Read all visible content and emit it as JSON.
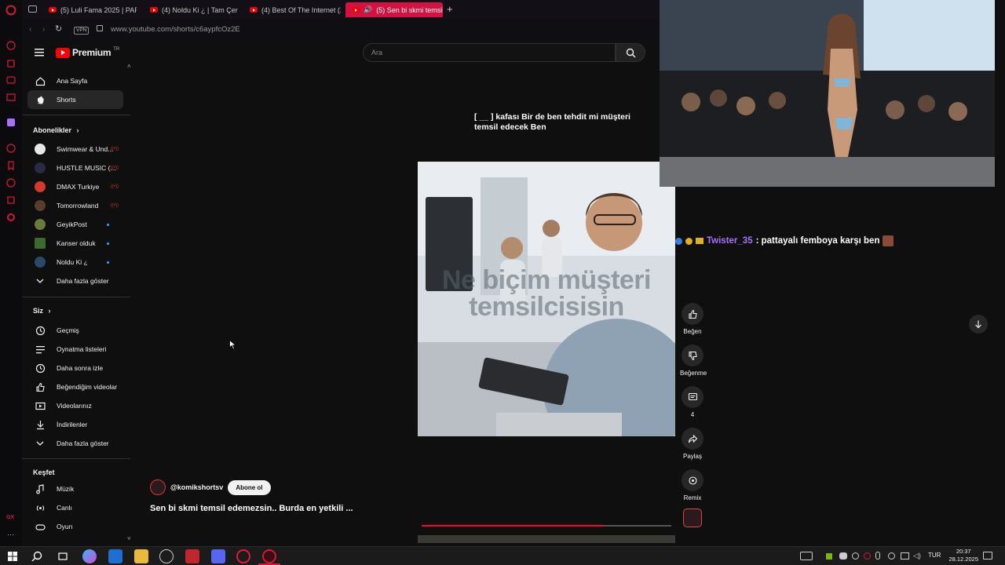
{
  "browser": {
    "tabs": [
      {
        "label": "(5) Luli Fama 2025 | PARA"
      },
      {
        "label": "(4) Noldu Ki ¿ | Tam Çere:"
      },
      {
        "label": "(4) Best Of The Internet (2"
      },
      {
        "label": "(5) Sen bi skmi temsil",
        "active": true
      }
    ],
    "address": "www.youtube.com/shorts/c6aypfcOz2E",
    "vpn_label": "VPN"
  },
  "yt": {
    "logo": "Premium",
    "logo_sup": "TR",
    "search_placeholder": "Ara"
  },
  "sidebar": {
    "main": [
      {
        "label": "Ana Sayfa",
        "icon": "home-icon"
      },
      {
        "label": "Shorts",
        "icon": "shorts-icon",
        "selected": true
      }
    ],
    "subs_title": "Abonelikler",
    "subs": [
      {
        "label": "Swimwear & Und...",
        "color": "#e8e8e8",
        "live": true
      },
      {
        "label": "HUSTLE MUSIC (...",
        "color": "#2a2a44",
        "live": true
      },
      {
        "label": "DMAX Turkiye",
        "color": "#d23b2a",
        "live": true
      },
      {
        "label": "Tomorrowland",
        "color": "#5a3d2b",
        "live": true
      },
      {
        "label": "GeyikPost",
        "color": "#6a7a3c",
        "dot": true
      },
      {
        "label": "Kanser olduk",
        "color": "#3b6a2b",
        "dot": true
      },
      {
        "label": "Noldu Ki ¿",
        "color": "#2b4a6a",
        "dot": true
      }
    ],
    "subs_more": "Daha fazla göster",
    "you_title": "Siz",
    "you": [
      {
        "label": "Geçmiş",
        "icon": "history-icon"
      },
      {
        "label": "Oynatma listeleri",
        "icon": "playlist-icon"
      },
      {
        "label": "Daha sonra izle",
        "icon": "clock-icon"
      },
      {
        "label": "Beğendiğim videolar",
        "icon": "thumb-up-icon"
      },
      {
        "label": "Videolarınız",
        "icon": "video-icon"
      },
      {
        "label": "İndirilenler",
        "icon": "download-icon"
      }
    ],
    "you_more": "Daha fazla göster",
    "explore_title": "Keşfet",
    "explore": [
      {
        "label": "Müzik",
        "icon": "music-icon"
      },
      {
        "label": "Canlı",
        "icon": "live-icon"
      },
      {
        "label": "Oyun",
        "icon": "game-icon"
      }
    ]
  },
  "short": {
    "caption": "[ __ ] kafası Bir de ben tehdit mi müşteri temsil edecek Ben",
    "overlay_text": "Ne biçim müşteri temsilcisisin",
    "channel": "@komikshortsv",
    "subscribe": "Abone ol",
    "title": "Sen bi skmi temsil edemezsin.. Burda en yetkili ...",
    "progress": 0.73
  },
  "actions": {
    "like": "Beğen",
    "dislike": "Beğenme",
    "comments": "4",
    "share": "Paylaş",
    "remix": "Remix"
  },
  "chat": {
    "user": "Twister_35",
    "message": ": pattayalı femboya karşı ben"
  },
  "taskbar": {
    "lang": "TUR",
    "time": "20:37",
    "date": "28.12.2025"
  }
}
